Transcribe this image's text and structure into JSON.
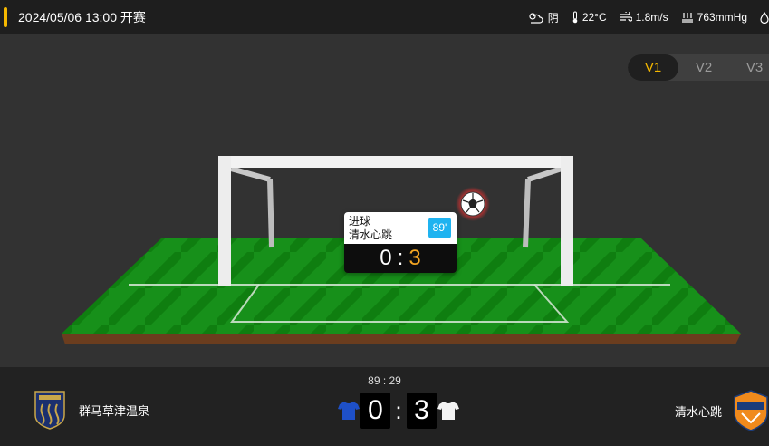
{
  "header": {
    "match_time": "2024/05/06 13:00 开赛"
  },
  "weather": {
    "condition": "阴",
    "temperature": "22°C",
    "wind": "1.8m/s",
    "pressure": "763mmHg"
  },
  "view_tabs": [
    "V1",
    "V2",
    "V3"
  ],
  "active_tab": "V1",
  "event_popup": {
    "type": "进球",
    "team": "清水心跳",
    "minute": "89'",
    "score_home": "0",
    "score_sep": ":",
    "score_away": "3"
  },
  "scoreboard": {
    "clock": "89 : 29",
    "home_team": "群马草津温泉",
    "away_team": "清水心跳",
    "home_score": "0",
    "away_score": "3",
    "sep": ":"
  },
  "colors": {
    "accent": "#f5b800",
    "minute_badge": "#1fb3f0",
    "away_score": "#f5a623",
    "pitch": "#1a8a1a"
  }
}
